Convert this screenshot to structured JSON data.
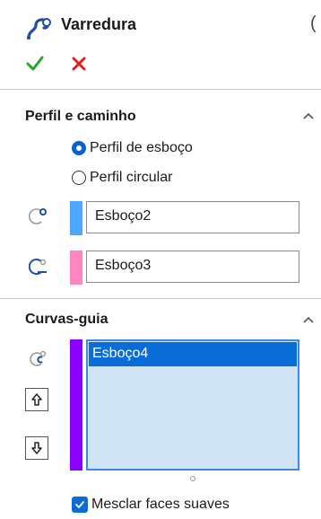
{
  "header": {
    "title": "Varredura",
    "feature_icon": "sweep-feature-icon",
    "help_glyph": "(",
    "ok_icon": "checkmark-icon",
    "cancel_icon": "x-icon"
  },
  "profile_path": {
    "title": "Perfil e caminho",
    "options": [
      {
        "label": "Perfil de esboço",
        "selected": true
      },
      {
        "label": "Perfil circular",
        "selected": false
      }
    ],
    "profile_field": {
      "value": "Esboço2",
      "icon": "profile-selection-icon",
      "color": "#4da6ff"
    },
    "path_field": {
      "value": "Esboço3",
      "icon": "path-selection-icon",
      "color": "#ff85c0"
    }
  },
  "guide_curves": {
    "title": "Curvas-guia",
    "items": [
      "Esboço4"
    ],
    "icon": "guide-curve-selection-icon",
    "swatch_color": "#8b00ff",
    "move_up_icon": "arrow-up-icon",
    "move_down_icon": "arrow-down-icon",
    "merge_faces_label": "Mesclar faces suaves",
    "merge_faces_checked": true
  },
  "colors": {
    "accent": "#0a6cd6",
    "ok_green": "#2aa52a",
    "cancel_red": "#e0201b",
    "list_bg": "#cfe3f5"
  }
}
